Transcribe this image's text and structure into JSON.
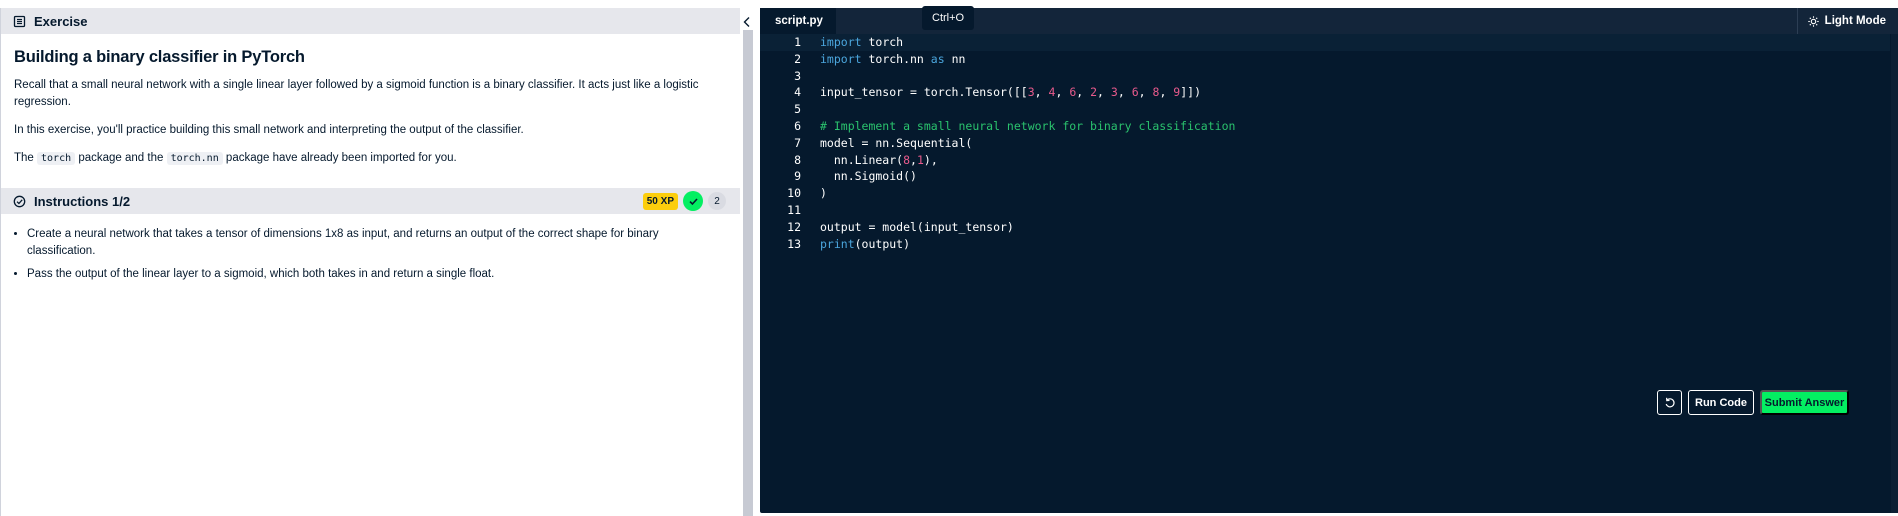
{
  "exercise": {
    "header": "Exercise",
    "title": "Building a binary classifier in PyTorch",
    "para1": "Recall that a small neural network with a single linear layer followed by a sigmoid function is a binary classifier. It acts just like a logistic regression.",
    "para2": "In this exercise, you'll practice building this small network and interpreting the output of the classifier.",
    "para3": {
      "prefix": "The ",
      "code1": "torch",
      "mid": " package and the ",
      "code2": "torch.nn",
      "suffix": " package have already been imported for you."
    }
  },
  "instructions": {
    "header": "Instructions 1/2",
    "xp": "50 XP",
    "count": "2",
    "items": [
      "Create a neural network that takes a tensor of dimensions 1x8 as input, and returns an output of the correct shape for binary classification.",
      "Pass the output of the linear layer to a sigmoid, which both takes in and return a single float."
    ]
  },
  "editor": {
    "tab": "script.py",
    "tooltip": "Ctrl+O",
    "theme_toggle": "Light Mode",
    "run_label": "Run Code",
    "submit_label": "Submit Answer",
    "lines": [
      {
        "n": "1",
        "tokens": [
          {
            "t": "import",
            "c": "kw"
          },
          {
            "t": " torch",
            "c": ""
          }
        ]
      },
      {
        "n": "2",
        "tokens": [
          {
            "t": "import",
            "c": "kw"
          },
          {
            "t": " torch.nn ",
            "c": ""
          },
          {
            "t": "as",
            "c": "kw"
          },
          {
            "t": " nn",
            "c": ""
          }
        ]
      },
      {
        "n": "3",
        "tokens": []
      },
      {
        "n": "4",
        "tokens": [
          {
            "t": "input_tensor = torch.Tensor([[",
            "c": ""
          },
          {
            "t": "3",
            "c": "num"
          },
          {
            "t": ", ",
            "c": ""
          },
          {
            "t": "4",
            "c": "num"
          },
          {
            "t": ", ",
            "c": ""
          },
          {
            "t": "6",
            "c": "num"
          },
          {
            "t": ", ",
            "c": ""
          },
          {
            "t": "2",
            "c": "num"
          },
          {
            "t": ", ",
            "c": ""
          },
          {
            "t": "3",
            "c": "num"
          },
          {
            "t": ", ",
            "c": ""
          },
          {
            "t": "6",
            "c": "num"
          },
          {
            "t": ", ",
            "c": ""
          },
          {
            "t": "8",
            "c": "num"
          },
          {
            "t": ", ",
            "c": ""
          },
          {
            "t": "9",
            "c": "num"
          },
          {
            "t": "]])",
            "c": ""
          }
        ]
      },
      {
        "n": "5",
        "tokens": []
      },
      {
        "n": "6",
        "tokens": [
          {
            "t": "# Implement a small neural network for binary classification",
            "c": "cmt"
          }
        ]
      },
      {
        "n": "7",
        "tokens": [
          {
            "t": "model = nn.Sequential(",
            "c": ""
          }
        ]
      },
      {
        "n": "8",
        "tokens": [
          {
            "t": "  nn.Linear(",
            "c": ""
          },
          {
            "t": "8",
            "c": "num"
          },
          {
            "t": ",",
            "c": ""
          },
          {
            "t": "1",
            "c": "num"
          },
          {
            "t": "),",
            "c": ""
          }
        ]
      },
      {
        "n": "9",
        "tokens": [
          {
            "t": "  nn.Sigmoid()",
            "c": ""
          }
        ]
      },
      {
        "n": "10",
        "tokens": [
          {
            "t": ")",
            "c": ""
          }
        ]
      },
      {
        "n": "11",
        "tokens": []
      },
      {
        "n": "12",
        "tokens": [
          {
            "t": "output = model(input_tensor)",
            "c": ""
          }
        ]
      },
      {
        "n": "13",
        "tokens": [
          {
            "t": "print",
            "c": "kw"
          },
          {
            "t": "(output)",
            "c": ""
          }
        ]
      }
    ]
  },
  "colors": {
    "editor_bg": "#05192d",
    "submit_green": "#03ef62",
    "xp_yellow": "#fcce0d",
    "keyword": "#4ba6dd",
    "number": "#e85a8c",
    "comment": "#2ac26d"
  },
  "icons": {
    "exercise": "document-icon",
    "instructions": "check-circle-icon",
    "theme": "sun-icon",
    "reset": "reset-icon",
    "collapse": "chevron-left-icon"
  }
}
